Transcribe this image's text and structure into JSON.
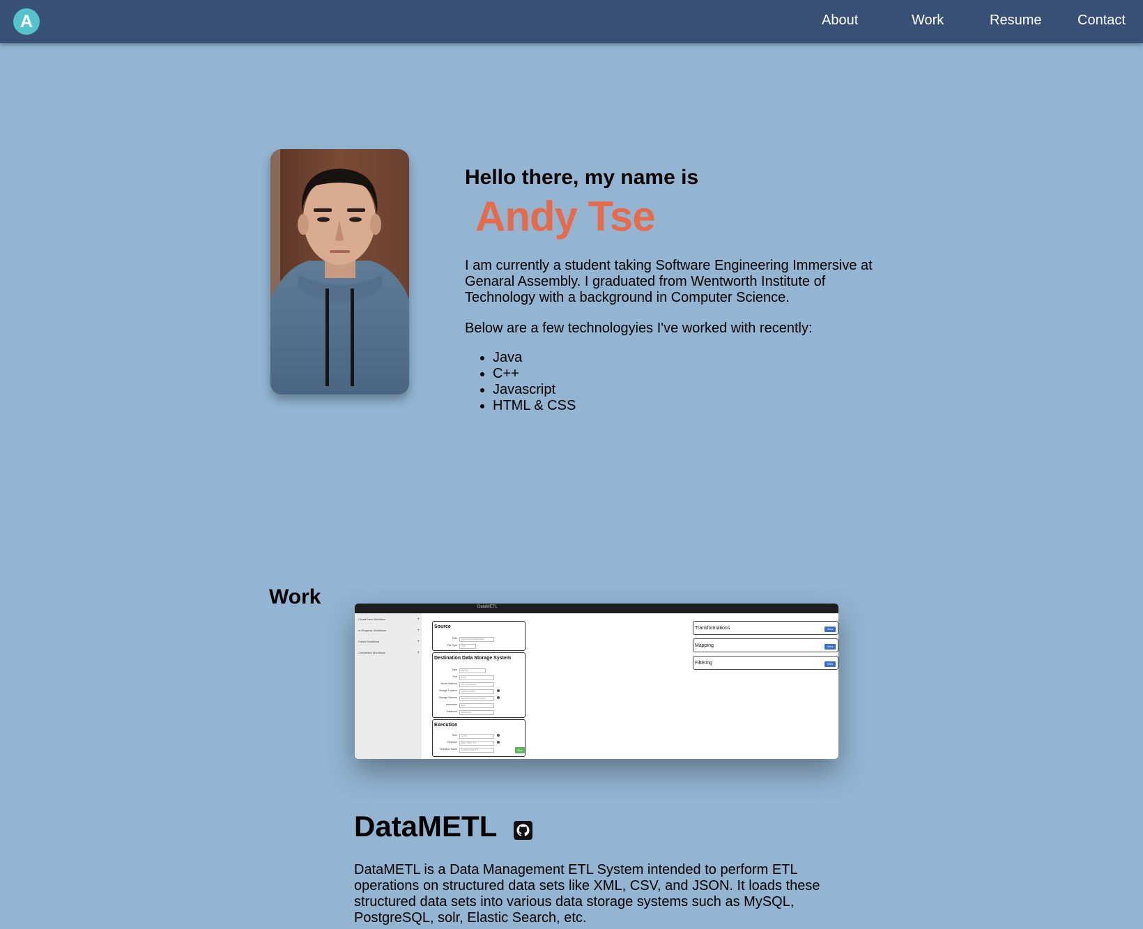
{
  "nav": {
    "logo_letter": "A",
    "links": [
      "About",
      "Work",
      "Resume",
      "Contact"
    ]
  },
  "hero": {
    "greeting": "Hello there, my name is",
    "name": "Andy Tse",
    "bio": "I am currently a student taking Software Engineering Immersive at Genaral Assembly. I graduated from Wentworth Institute of Technology with a background in Computer Science.",
    "tech_intro": "Below are a few technologyies I've worked with recently:",
    "technologies": [
      "Java",
      "C++",
      "Javascript",
      "HTML & CSS"
    ]
  },
  "work": {
    "heading": "Work",
    "project": {
      "title": "DataMETL",
      "description": "DataMETL is a Data Management ETL System intended to perform ETL operations on structured data sets like XML, CSV, and JSON. It loads these structured data sets into various data storage systems such as MySQL, PostgreSQL, solr, Elastic Search, etc.",
      "screenshot": {
        "app_title": "DataMETL",
        "sidebar_items": [
          "Create New Workflow",
          "In Progress Workflows",
          "Failed Workflows",
          "Completed Workflows"
        ],
        "source_title": "Source",
        "source_rows": [
          {
            "label": "Path",
            "value": "/users/andy/data/sam"
          },
          {
            "label": "File Type",
            "value": "CSV"
          }
        ],
        "destination_title": "Destination Data Storage System",
        "destination_rows": [
          {
            "label": "Type",
            "value": "MySQL"
          },
          {
            "label": "Port",
            "value": "3306"
          },
          {
            "label": "Server Address",
            "value": "http://localhost"
          },
          {
            "label": "Storage Location",
            "value": "schema.table"
          },
          {
            "label": "Storage Schema",
            "value": "/schemas/schema.json"
          },
          {
            "label": "Username",
            "value": "user"
          },
          {
            "label": "Password",
            "value": "password"
          }
        ],
        "execution_title": "Execution",
        "execution_rows": [
          {
            "label": "Time",
            "value": "12:00"
          },
          {
            "label": "Schedule",
            "value": "Mon, Wed, Fri"
          },
          {
            "label": "Workflow Name",
            "value": "Contact Info ETL"
          }
        ],
        "run_label": "Run",
        "right_panels": [
          "Transformations",
          "Mapping",
          "Filtering"
        ],
        "right_panel_button": "View"
      }
    }
  },
  "colors": {
    "page_background": "#93b5d2",
    "navbar": "#384f76",
    "logo": "#55c3cc",
    "name_accent": "#e56b4b"
  }
}
